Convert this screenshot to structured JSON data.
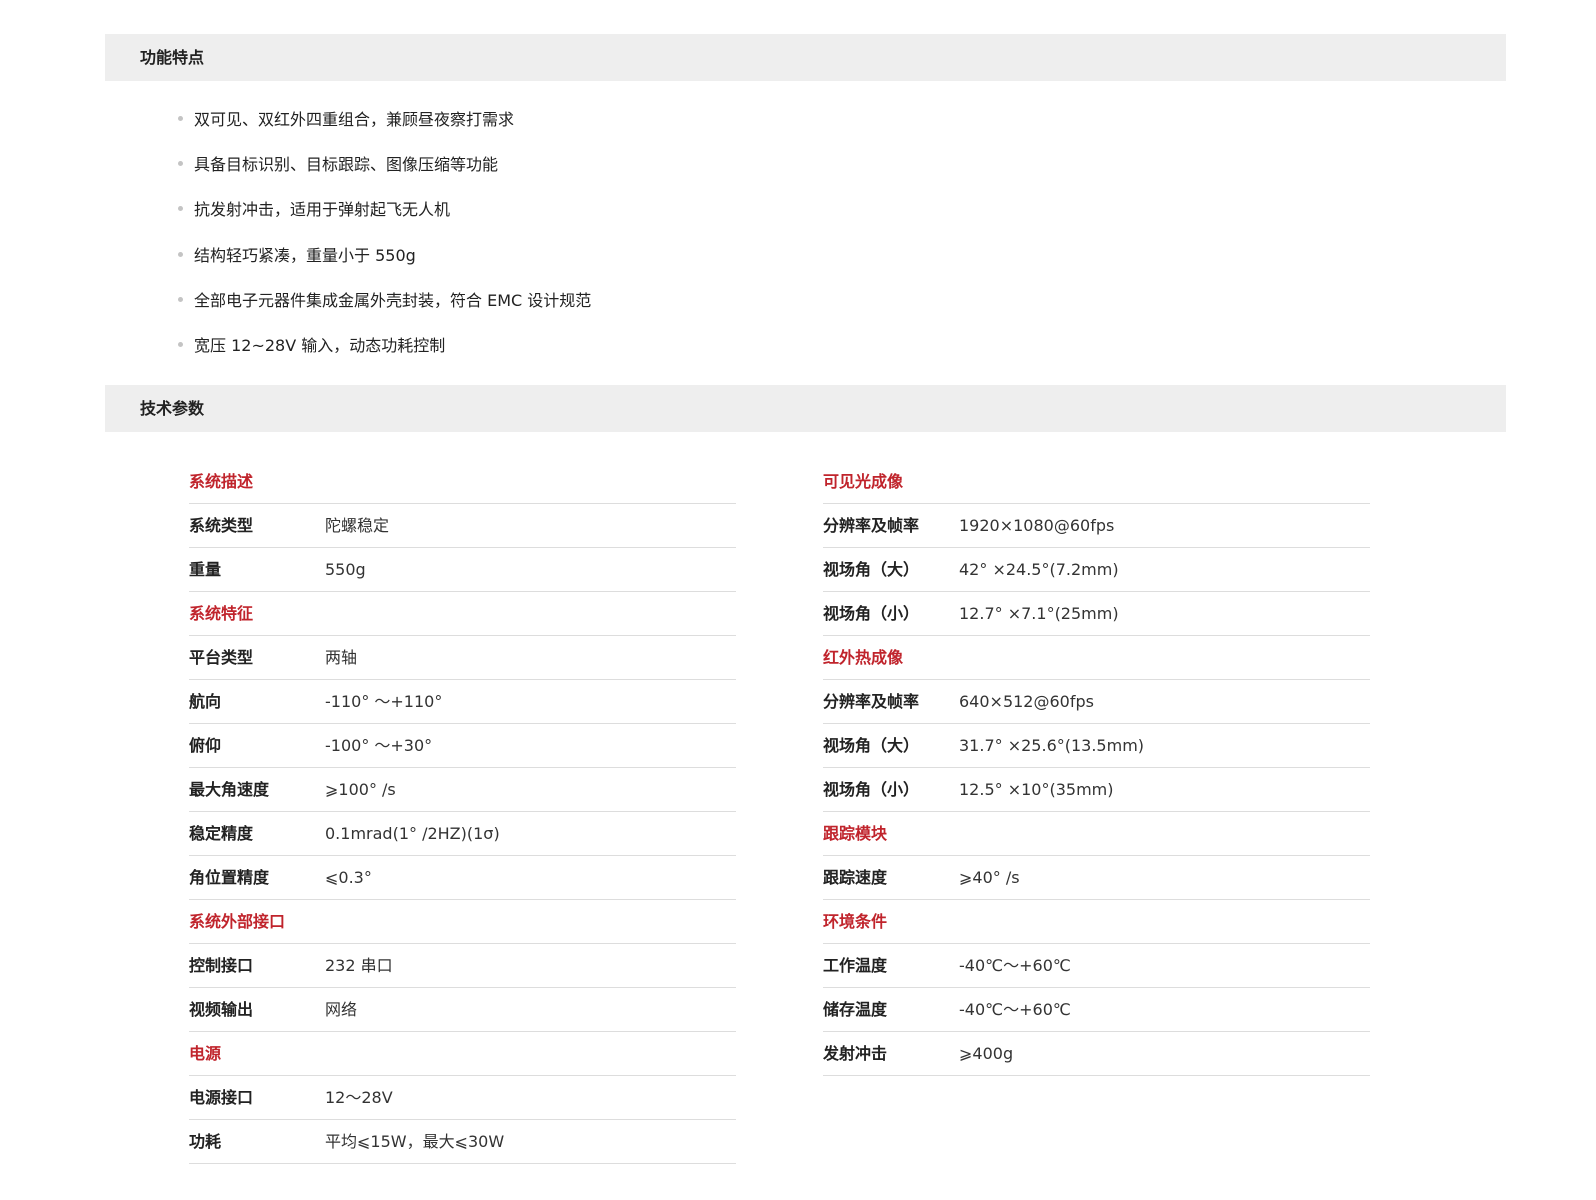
{
  "features": {
    "title": "功能特点",
    "items": [
      "双可见、双红外四重组合，兼顾昼夜察打需求",
      "具备目标识别、目标跟踪、图像压缩等功能",
      "抗发射冲击，适用于弹射起飞无人机",
      "结构轻巧紧凑，重量小于 550g",
      "全部电子元器件集成金属外壳封装，符合 EMC 设计规范",
      "宽压 12~28V 输入，动态功耗控制"
    ]
  },
  "specs": {
    "title": "技术参数",
    "left": {
      "g1": "系统描述",
      "r1": {
        "label": "系统类型",
        "value": "陀螺稳定"
      },
      "r2": {
        "label": "重量",
        "value": "550g"
      },
      "g2": "系统特征",
      "r3": {
        "label": "平台类型",
        "value": "两轴"
      },
      "r4": {
        "label": "航向",
        "value": "-110° ～+110°"
      },
      "r5": {
        "label": "俯仰",
        "value": "-100° ～+30°"
      },
      "r6": {
        "label": "最大角速度",
        "value": "⩾100° /s"
      },
      "r7": {
        "label": "稳定精度",
        "value": "0.1mrad(1° /2HZ)(1σ)"
      },
      "r8": {
        "label": "角位置精度",
        "value": "⩽0.3°"
      },
      "g3": "系统外部接口",
      "r9": {
        "label": "控制接口",
        "value": "232 串口"
      },
      "r10": {
        "label": "视频输出",
        "value": "网络"
      },
      "g4": "电源",
      "r11": {
        "label": "电源接口",
        "value": "12～28V"
      },
      "r12": {
        "label": "功耗",
        "value": "平均⩽15W，最大⩽30W"
      }
    },
    "right": {
      "g1": "可见光成像",
      "r1": {
        "label": "分辨率及帧率",
        "value": "1920×1080@60fps"
      },
      "r2": {
        "label": "视场角（大）",
        "value": "42° ×24.5°(7.2mm)"
      },
      "r3": {
        "label": "视场角（小）",
        "value": "12.7° ×7.1°(25mm)"
      },
      "g2": "红外热成像",
      "r4": {
        "label": "分辨率及帧率",
        "value": "640×512@60fps"
      },
      "r5": {
        "label": "视场角（大）",
        "value": "31.7° ×25.6°(13.5mm)"
      },
      "r6": {
        "label": "视场角（小）",
        "value": "12.5° ×10°(35mm)"
      },
      "g3": "跟踪模块",
      "r7": {
        "label": "跟踪速度",
        "value": "⩾40° /s"
      },
      "g4": "环境条件",
      "r8": {
        "label": "工作温度",
        "value": "-40℃～+60℃"
      },
      "r9": {
        "label": "储存温度",
        "value": "-40℃～+60℃"
      },
      "r10": {
        "label": "发射冲击",
        "value": "⩾400g"
      }
    }
  },
  "colors": {
    "accent": "#c0242c",
    "bar_bg": "#eeeeee",
    "divider": "#dddddd"
  }
}
